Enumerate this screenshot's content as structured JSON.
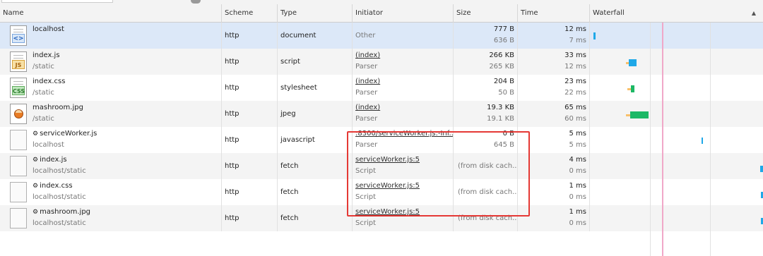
{
  "columns": {
    "name": "Name",
    "scheme": "Scheme",
    "type": "Type",
    "initiator": "Initiator",
    "size": "Size",
    "time": "Time",
    "waterfall": "Waterfall"
  },
  "sort_indicator": "▲",
  "colors": {
    "selected_row": "#dce8f8",
    "waiting_bar": "#f8c06b",
    "download_bar": "#1fa8e8",
    "download_bar_green": "#1db866",
    "highlight_box": "#e53935"
  },
  "rows": [
    {
      "icon": "html-file-icon",
      "name": "localhost",
      "path": "",
      "scheme": "http",
      "type": "document",
      "initiator": "Other",
      "initiator_sub": "",
      "size": "777 B",
      "size_sub": "636 B",
      "time": "12 ms",
      "time_sub": "7 ms"
    },
    {
      "icon": "js-file-icon",
      "name": "index.js",
      "path": "/static",
      "scheme": "http",
      "type": "script",
      "initiator": "(index)",
      "initiator_sub": "Parser",
      "size": "266 KB",
      "size_sub": "265 KB",
      "time": "33 ms",
      "time_sub": "12 ms"
    },
    {
      "icon": "css-file-icon",
      "name": "index.css",
      "path": "/static",
      "scheme": "http",
      "type": "stylesheet",
      "initiator": "(index)",
      "initiator_sub": "Parser",
      "size": "204 B",
      "size_sub": "50 B",
      "time": "23 ms",
      "time_sub": "22 ms"
    },
    {
      "icon": "image-file-icon",
      "name": "mashroom.jpg",
      "path": "/static",
      "scheme": "http",
      "type": "jpeg",
      "initiator": "(index)",
      "initiator_sub": "Parser",
      "size": "19.3 KB",
      "size_sub": "19.1 KB",
      "time": "65 ms",
      "time_sub": "60 ms"
    },
    {
      "icon": "blank-file-icon",
      "name": "serviceWorker.js",
      "path": "localhost",
      "scheme": "http",
      "type": "javascript",
      "initiator": ":8300/serviceWorker.js:-Inf...",
      "initiator_sub": "Parser",
      "size": "0 B",
      "size_sub": "645 B",
      "time": "5 ms",
      "time_sub": "5 ms"
    },
    {
      "icon": "blank-file-icon",
      "name": "index.js",
      "path": "localhost/static",
      "scheme": "http",
      "type": "fetch",
      "initiator": "serviceWorker.js:5",
      "initiator_sub": "Script",
      "size": "(from disk cach...",
      "size_sub": "",
      "time": "4 ms",
      "time_sub": "0 ms"
    },
    {
      "icon": "blank-file-icon",
      "name": "index.css",
      "path": "localhost/static",
      "scheme": "http",
      "type": "fetch",
      "initiator": "serviceWorker.js:5",
      "initiator_sub": "Script",
      "size": "(from disk cach...",
      "size_sub": "",
      "time": "1 ms",
      "time_sub": "0 ms"
    },
    {
      "icon": "blank-file-icon",
      "name": "mashroom.jpg",
      "path": "localhost/static",
      "scheme": "http",
      "type": "fetch",
      "initiator": "serviceWorker.js:5",
      "initiator_sub": "Script",
      "size": "(from disk cach...",
      "size_sub": "",
      "time": "1 ms",
      "time_sub": "0 ms"
    }
  ]
}
